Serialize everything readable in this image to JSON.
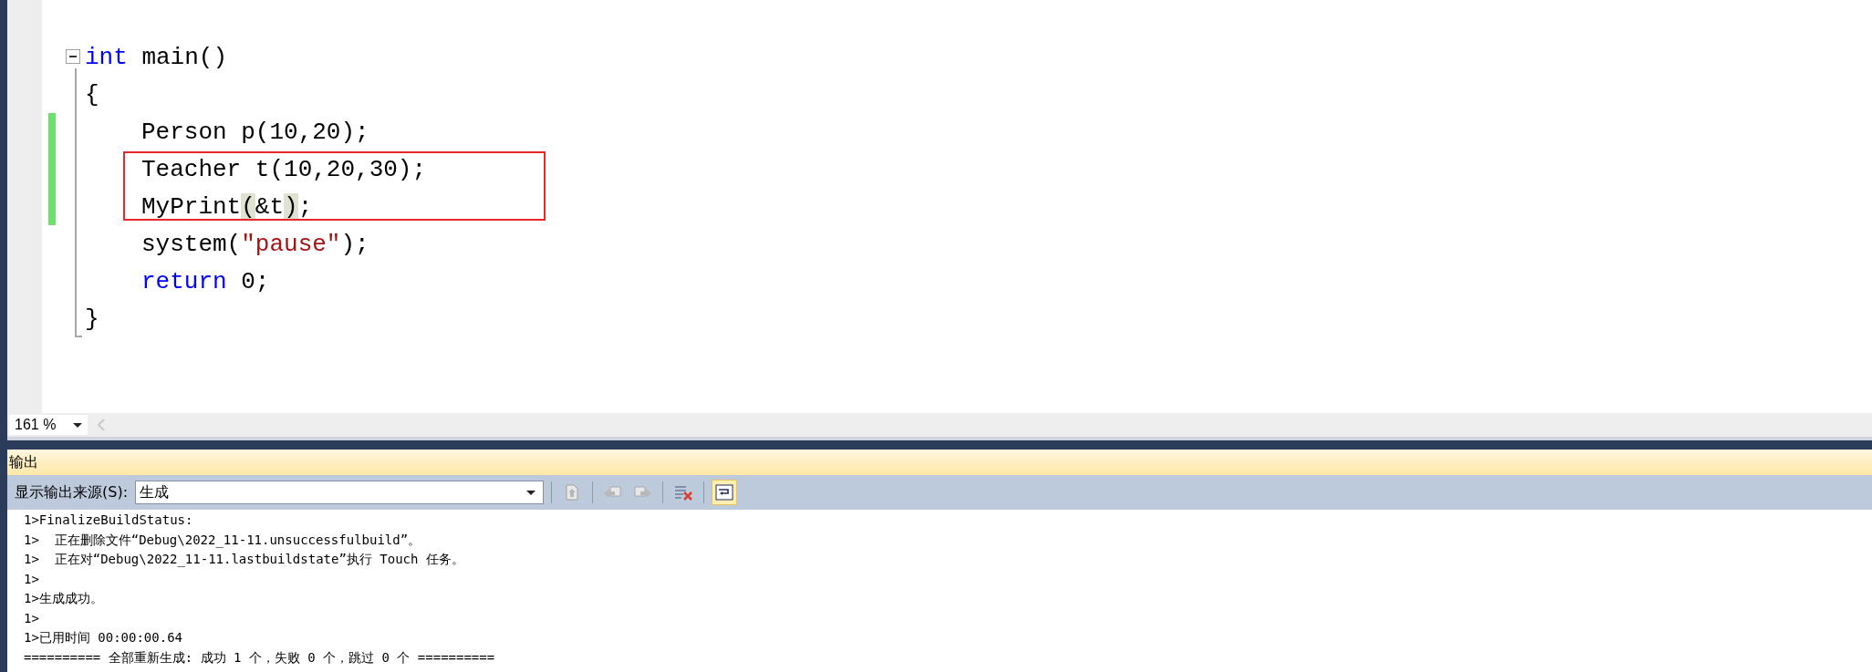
{
  "editor": {
    "lines": [
      {
        "changed": false,
        "indented": false,
        "tokens": [
          {
            "kind": "keyword",
            "text": "int"
          },
          {
            "kind": "plain",
            "text": " main()"
          }
        ]
      },
      {
        "changed": false,
        "indented": false,
        "tokens": [
          {
            "kind": "plain",
            "text": "{"
          }
        ]
      },
      {
        "changed": true,
        "indented": true,
        "tokens": [
          {
            "kind": "plain",
            "text": "Person p(10,20);"
          }
        ]
      },
      {
        "changed": true,
        "indented": true,
        "tokens": [
          {
            "kind": "plain",
            "text": "Teacher t(10,20,30);"
          }
        ]
      },
      {
        "changed": true,
        "indented": true,
        "tokens": [
          {
            "kind": "plain",
            "text": "MyPrint"
          },
          {
            "kind": "match",
            "text": "("
          },
          {
            "kind": "plain",
            "text": "&t"
          },
          {
            "kind": "match",
            "text": ")"
          },
          {
            "kind": "plain",
            "text": ";"
          }
        ]
      },
      {
        "changed": false,
        "indented": true,
        "tokens": [
          {
            "kind": "plain",
            "text": "system("
          },
          {
            "kind": "string",
            "text": "\"pause\""
          },
          {
            "kind": "plain",
            "text": ");"
          }
        ]
      },
      {
        "changed": false,
        "indented": true,
        "tokens": [
          {
            "kind": "keyword",
            "text": "return"
          },
          {
            "kind": "plain",
            "text": " 0;"
          }
        ]
      },
      {
        "changed": false,
        "indented": false,
        "tokens": [
          {
            "kind": "plain",
            "text": "}"
          }
        ]
      }
    ],
    "zoom": "161 %"
  },
  "output": {
    "title": "输出",
    "source_label": "显示输出来源(S):",
    "source_value": "生成",
    "tools": [
      {
        "kind": "goto",
        "selected": false
      },
      {
        "kind": "prev",
        "selected": false
      },
      {
        "kind": "next",
        "selected": false
      },
      {
        "kind": "clear",
        "selected": false
      },
      {
        "kind": "wrap",
        "selected": true
      }
    ],
    "lines": [
      "1>FinalizeBuildStatus:",
      "1>  正在删除文件“Debug\\2022_11-11.unsuccessfulbuild”。",
      "1>  正在对“Debug\\2022_11-11.lastbuildstate”执行 Touch 任务。",
      "1>",
      "1>生成成功。",
      "1>",
      "1>已用时间 00:00:00.64",
      "========== 全部重新生成: 成功 1 个，失败 0 个，跳过 0 个 =========="
    ]
  }
}
